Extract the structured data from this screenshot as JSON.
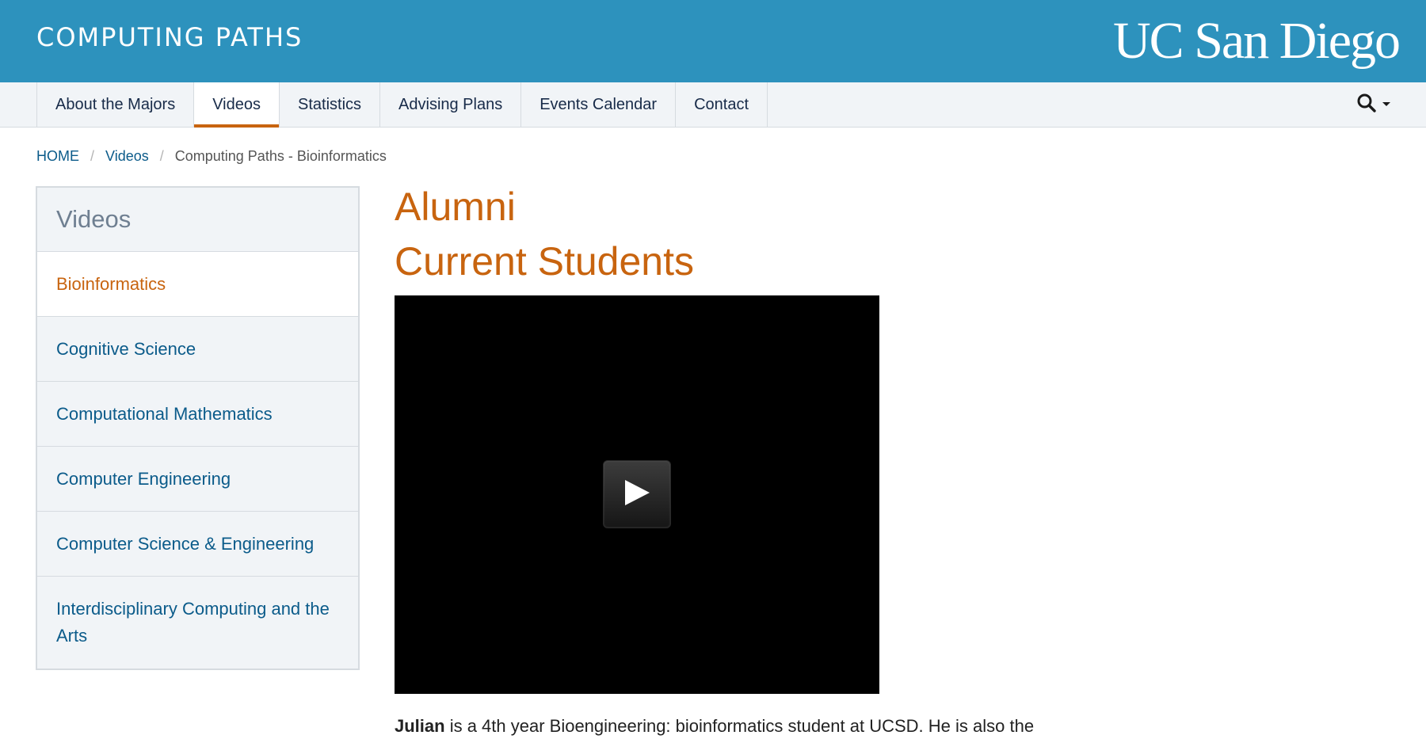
{
  "header": {
    "site_title": "COMPUTING PATHS",
    "logo_text": "UC San Diego",
    "background": "#2d92bd"
  },
  "nav": {
    "items": [
      {
        "label": "About the Majors",
        "active": false
      },
      {
        "label": "Videos",
        "active": true
      },
      {
        "label": "Statistics",
        "active": false
      },
      {
        "label": "Advising Plans",
        "active": false
      },
      {
        "label": "Events Calendar",
        "active": false
      },
      {
        "label": "Contact",
        "active": false
      }
    ],
    "search_icon": "search-icon",
    "accent": "#c8640f"
  },
  "breadcrumb": {
    "home": "HOME",
    "section": "Videos",
    "current": "Computing Paths - Bioinformatics"
  },
  "sidebar": {
    "heading": "Videos",
    "items": [
      {
        "label": "Bioinformatics",
        "active": true
      },
      {
        "label": "Cognitive Science",
        "active": false
      },
      {
        "label": "Computational Mathematics",
        "active": false
      },
      {
        "label": "Computer Engineering",
        "active": false
      },
      {
        "label": "Computer Science & Engineering",
        "active": false
      },
      {
        "label": "Interdisciplinary Computing and the Arts",
        "active": false
      }
    ]
  },
  "main": {
    "title_alumni": "Alumni",
    "title_current": "Current Students",
    "video": {
      "play_icon": "play-icon"
    },
    "description": {
      "name": "Julian",
      "text": " is a 4th year Bioengineering: bioinformatics student at UCSD. He is also the"
    }
  }
}
